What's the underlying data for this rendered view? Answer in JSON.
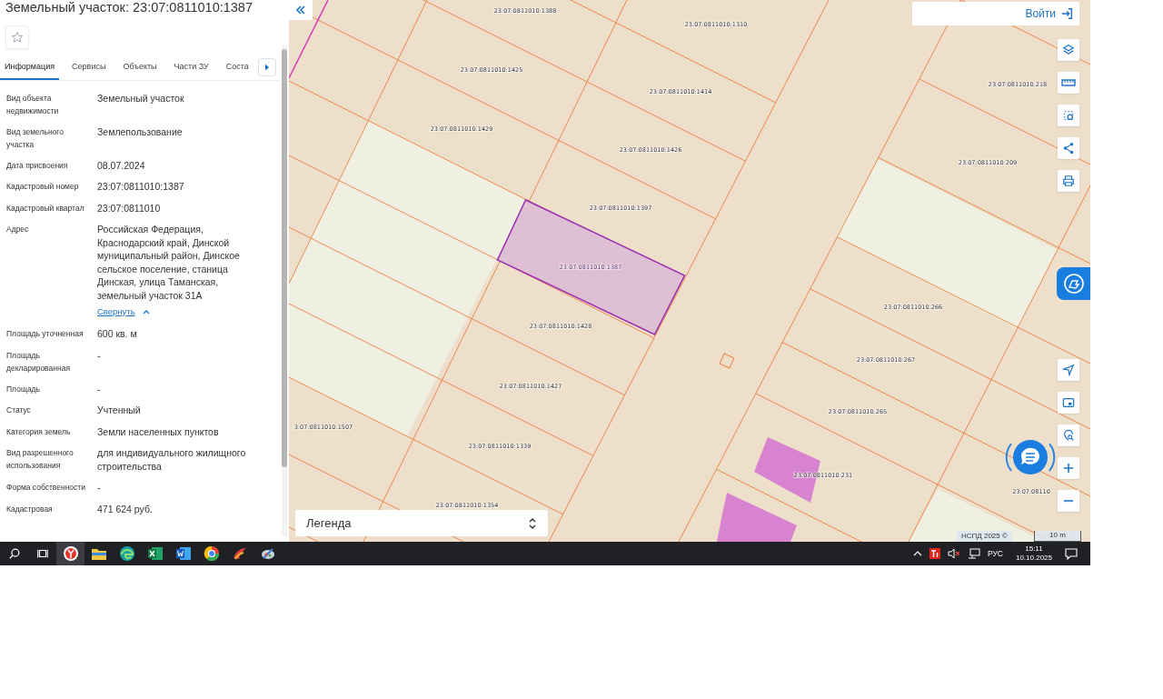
{
  "panel": {
    "title": "Земельный участок: 23:07:0811010:1387",
    "tabs": [
      {
        "label": "Информация",
        "selected": true
      },
      {
        "label": "Сервисы",
        "selected": false
      },
      {
        "label": "Объекты",
        "selected": false
      },
      {
        "label": "Части ЗУ",
        "selected": false
      },
      {
        "label": "Соста",
        "selected": false
      }
    ],
    "fields": [
      {
        "label": "Вид объекта недвижимости",
        "value": "Земельный участок"
      },
      {
        "label": "Вид земельного участка",
        "value": "Землепользование"
      },
      {
        "label": "Дата присвоения",
        "value": "08.07.2024"
      },
      {
        "label": "Кадастровый номер",
        "value": "23:07:0811010:1387"
      },
      {
        "label": "Кадастровый квартал",
        "value": "23:07:0811010"
      },
      {
        "label": "Адрес",
        "value": "Российская Федерация, Краснодарский край, Динской муниципальный район, Динское сельское поселение, станица Динская, улица Таманская, земельный участок 31А",
        "link": "Свернуть"
      },
      {
        "label": "Площадь уточненная",
        "value": "600 кв. м"
      },
      {
        "label": "Площадь декларированная",
        "value": "-"
      },
      {
        "label": "Площадь",
        "value": "-"
      },
      {
        "label": "Статус",
        "value": "Учтенный"
      },
      {
        "label": "Категория земель",
        "value": "Земли населенных пунктов"
      },
      {
        "label": "Вид разрешенного использования",
        "value": "для индивидуального жилищного строительства"
      },
      {
        "label": "Форма собственности",
        "value": "-"
      },
      {
        "label": "Кадастровая",
        "value": "471 624 руб."
      }
    ]
  },
  "map": {
    "login_button": "Войти",
    "legend": "Легенда",
    "attribution": "НСПД 2025 ©",
    "scale": "10 m",
    "parcels": [
      {
        "label": "23:07:0811010:1388",
        "selected": false
      },
      {
        "label": "23:07:0811010:1310",
        "selected": false
      },
      {
        "label": "23:07:0811010:1425",
        "selected": false
      },
      {
        "label": "23:07:0811010:1414",
        "selected": false
      },
      {
        "label": "23:07:0811010:1429",
        "selected": false
      },
      {
        "label": "23:07:0811010:1426",
        "selected": false
      },
      {
        "label": "23:07:0811010:1397",
        "selected": false
      },
      {
        "label": "23:07:0811010:1387",
        "selected": true
      },
      {
        "label": "23:07:0811010:1428",
        "selected": false
      },
      {
        "label": "23:07:0811010:1427",
        "selected": false
      },
      {
        "label": "3:07:0811010:1507",
        "selected": false
      },
      {
        "label": "23:07:0811010:1339",
        "selected": false
      },
      {
        "label": "23:07:0811010:1354",
        "selected": false
      },
      {
        "label": "23:07:0811010:218",
        "selected": false
      },
      {
        "label": "23:07:0811010:209",
        "selected": false
      },
      {
        "label": "23:07:0811010:266",
        "selected": false
      },
      {
        "label": "23:07:0811010:267",
        "selected": false
      },
      {
        "label": "23:07:0811010:265",
        "selected": false
      },
      {
        "label": "23:07:0811010:231",
        "selected": false
      },
      {
        "label": "23:07:08110",
        "selected": false
      }
    ]
  },
  "taskbar": {
    "apps": [
      {
        "kind": "search",
        "selected": false
      },
      {
        "kind": "taskview",
        "selected": false
      },
      {
        "kind": "browser",
        "selected": true
      },
      {
        "kind": "folder",
        "selected": false
      },
      {
        "kind": "globe",
        "selected": false
      },
      {
        "kind": "sheet",
        "selected": false
      },
      {
        "kind": "doc",
        "selected": false
      },
      {
        "kind": "wheel",
        "selected": false
      },
      {
        "kind": "brush",
        "selected": false
      },
      {
        "kind": "tool",
        "selected": false
      }
    ],
    "language": "РУС",
    "time": "15:11",
    "date": "10.10.2025"
  }
}
